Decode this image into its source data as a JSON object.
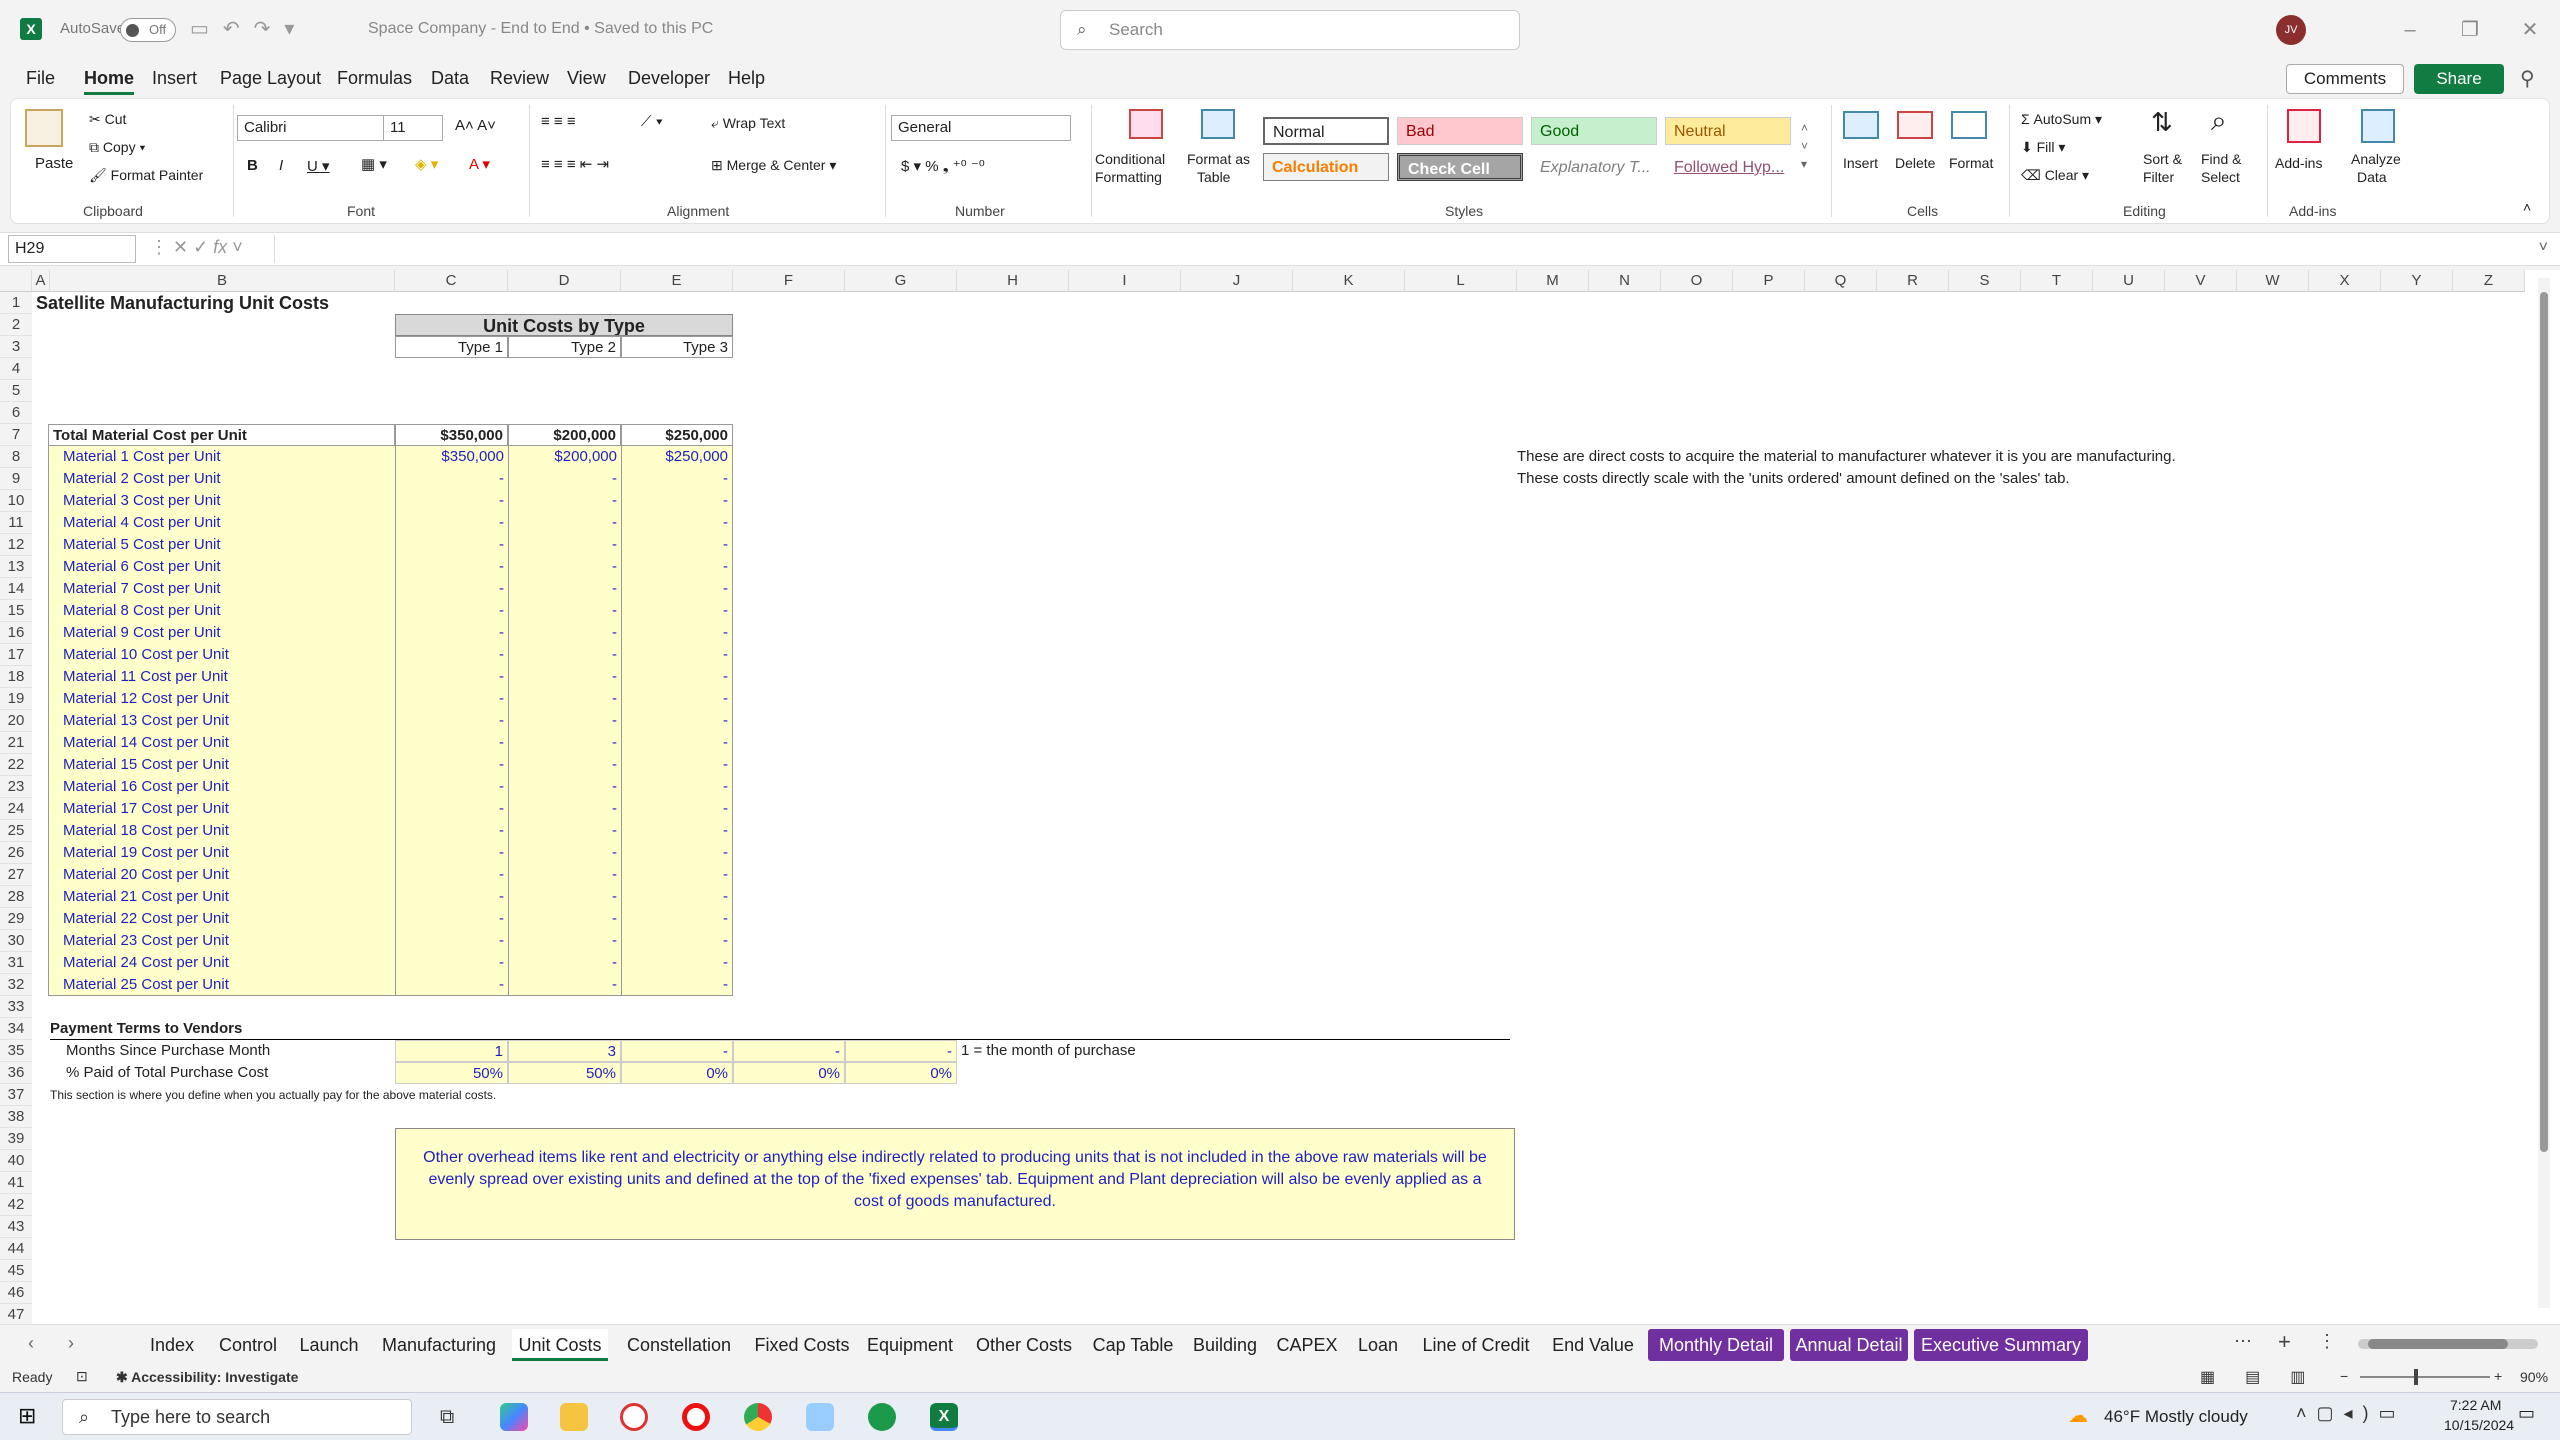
{
  "title": {
    "autosave": "AutoSave",
    "toggle": "Off",
    "doc": "Space Company - End to End • Saved to this PC",
    "search": "Search",
    "avatar": "JV"
  },
  "menu": [
    "File",
    "Home",
    "Insert",
    "Page Layout",
    "Formulas",
    "Data",
    "Review",
    "View",
    "Developer",
    "Help"
  ],
  "actions": {
    "comments": "Comments",
    "share": "Share"
  },
  "ribbon": {
    "paste": "Paste",
    "cut": "Cut",
    "copy": "Copy",
    "format_painter": "Format Painter",
    "clipboard": "Clipboard",
    "font_name": "Calibri",
    "font_size": "11",
    "font": "Font",
    "wrap": "Wrap Text",
    "merge": "Merge & Center",
    "alignment": "Alignment",
    "numfmt": "General",
    "number": "Number",
    "cond": "Conditional",
    "cond2": "Formatting",
    "fmt_table": "Format as",
    "fmt_table2": "Table",
    "styles": [
      "Normal",
      "Bad",
      "Good",
      "Neutral",
      "Calculation",
      "Check Cell",
      "Explanatory T...",
      "Followed Hyp..."
    ],
    "styles_lbl": "Styles",
    "insert": "Insert",
    "delete": "Delete",
    "format": "Format",
    "cells": "Cells",
    "autosum": "AutoSum",
    "fill": "Fill",
    "clear": "Clear",
    "sort": "Sort &",
    "sort2": "Filter",
    "find": "Find &",
    "find2": "Select",
    "editing": "Editing",
    "addins": "Add-ins",
    "analyze": "Analyze",
    "analyze2": "Data",
    "addins_lbl": "Add-ins"
  },
  "namebox": "H29",
  "columns": [
    "A",
    "B",
    "C",
    "D",
    "E",
    "F",
    "G",
    "H",
    "I",
    "J",
    "K",
    "L",
    "M",
    "N",
    "O",
    "P",
    "Q",
    "R",
    "S",
    "T",
    "U",
    "V",
    "W",
    "X",
    "Y",
    "Z"
  ],
  "sheet": {
    "title": "Satellite Manufacturing Unit Costs",
    "unit_costs_header": "Unit Costs by Type",
    "types": [
      "Type 1",
      "Type 2",
      "Type 3"
    ],
    "total_label": "Total Material Cost per Unit",
    "totals": [
      "$350,000",
      "$200,000",
      "$250,000"
    ],
    "materials": [
      {
        "label": "Material 1 Cost per Unit",
        "v": [
          "$350,000",
          "$200,000",
          "$250,000"
        ]
      },
      {
        "label": "Material 2 Cost per Unit",
        "v": [
          "-",
          "-",
          "-"
        ]
      },
      {
        "label": "Material 3 Cost per Unit",
        "v": [
          "-",
          "-",
          "-"
        ]
      },
      {
        "label": "Material 4 Cost per Unit",
        "v": [
          "-",
          "-",
          "-"
        ]
      },
      {
        "label": "Material 5 Cost per Unit",
        "v": [
          "-",
          "-",
          "-"
        ]
      },
      {
        "label": "Material 6 Cost per Unit",
        "v": [
          "-",
          "-",
          "-"
        ]
      },
      {
        "label": "Material 7 Cost per Unit",
        "v": [
          "-",
          "-",
          "-"
        ]
      },
      {
        "label": "Material 8 Cost per Unit",
        "v": [
          "-",
          "-",
          "-"
        ]
      },
      {
        "label": "Material 9 Cost per Unit",
        "v": [
          "-",
          "-",
          "-"
        ]
      },
      {
        "label": "Material 10 Cost per Unit",
        "v": [
          "-",
          "-",
          "-"
        ]
      },
      {
        "label": "Material 11 Cost per Unit",
        "v": [
          "-",
          "-",
          "-"
        ]
      },
      {
        "label": "Material 12 Cost per Unit",
        "v": [
          "-",
          "-",
          "-"
        ]
      },
      {
        "label": "Material 13 Cost per Unit",
        "v": [
          "-",
          "-",
          "-"
        ]
      },
      {
        "label": "Material 14 Cost per Unit",
        "v": [
          "-",
          "-",
          "-"
        ]
      },
      {
        "label": "Material 15 Cost per Unit",
        "v": [
          "-",
          "-",
          "-"
        ]
      },
      {
        "label": "Material 16 Cost per Unit",
        "v": [
          "-",
          "-",
          "-"
        ]
      },
      {
        "label": "Material 17 Cost per Unit",
        "v": [
          "-",
          "-",
          "-"
        ]
      },
      {
        "label": "Material 18 Cost per Unit",
        "v": [
          "-",
          "-",
          "-"
        ]
      },
      {
        "label": "Material 19 Cost per Unit",
        "v": [
          "-",
          "-",
          "-"
        ]
      },
      {
        "label": "Material 20 Cost per Unit",
        "v": [
          "-",
          "-",
          "-"
        ]
      },
      {
        "label": "Material 21 Cost per Unit",
        "v": [
          "-",
          "-",
          "-"
        ]
      },
      {
        "label": "Material 22 Cost per Unit",
        "v": [
          "-",
          "-",
          "-"
        ]
      },
      {
        "label": "Material 23 Cost per Unit",
        "v": [
          "-",
          "-",
          "-"
        ]
      },
      {
        "label": "Material 24 Cost per Unit",
        "v": [
          "-",
          "-",
          "-"
        ]
      },
      {
        "label": "Material 25 Cost per Unit",
        "v": [
          "-",
          "-",
          "-"
        ]
      }
    ],
    "note1": "These are direct costs to acquire the material to manufacturer whatever it is you are manufacturing.",
    "note2": "These costs directly scale with the 'units ordered' amount defined on the 'sales' tab.",
    "payment_header": "Payment Terms to Vendors",
    "months_label": "Months Since Purchase Month",
    "months": [
      "1",
      "3",
      "-",
      "-",
      "-"
    ],
    "months_note": "1 =  the month of purchase",
    "paid_label": "% Paid of Total Purchase Cost",
    "paid": [
      "50%",
      "50%",
      "0%",
      "0%",
      "0%"
    ],
    "section_note": "This section is where you define when you actually pay for the above material costs.",
    "overhead": "Other overhead items like rent and electricity or anything else indirectly related to producing units that is not included in the above raw materials will be evenly spread over existing units and defined at the top of the 'fixed expenses' tab. Equipment and Plant depreciation will also be evenly applied as a cost of goods manufactured."
  },
  "tabs": [
    "Index",
    "Control",
    "Launch",
    "Manufacturing",
    "Unit Costs",
    "Constellation",
    "Fixed Costs",
    "Equipment",
    "Other Costs",
    "Cap Table",
    "Building",
    "CAPEX",
    "Loan",
    "Line of Credit",
    "End Value",
    "Monthly Detail",
    "Annual Detail",
    "Executive Summary"
  ],
  "status": {
    "ready": "Ready",
    "access": "Accessibility: Investigate",
    "zoom": "90%"
  },
  "taskbar": {
    "search": "Type here to search",
    "weather": "46°F  Mostly cloudy",
    "time": "7:22 AM",
    "date": "10/15/2024"
  }
}
